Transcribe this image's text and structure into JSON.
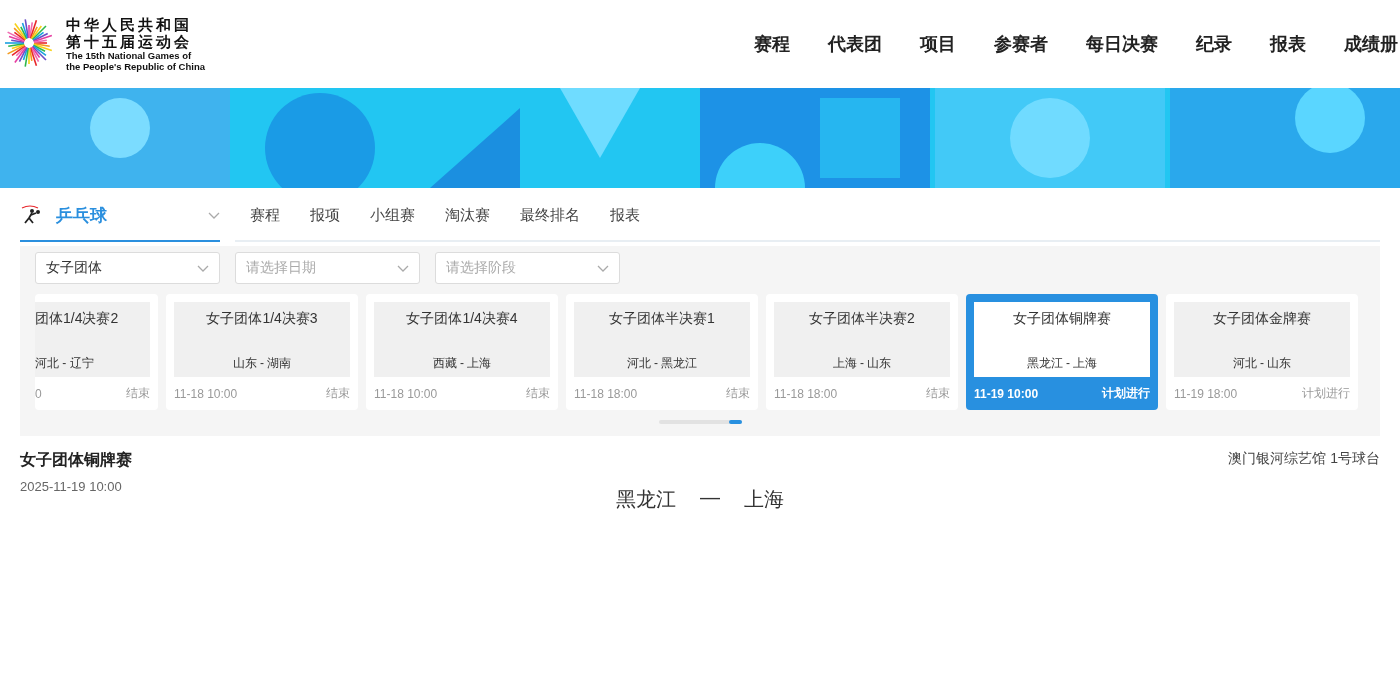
{
  "logo": {
    "title_cn": [
      "中华人民共和国",
      "第十五届运动会"
    ],
    "title_en": [
      "The 15th National Games of",
      "the People's Republic of China"
    ]
  },
  "nav": [
    {
      "label": "赛程"
    },
    {
      "label": "代表团"
    },
    {
      "label": "项目"
    },
    {
      "label": "参赛者"
    },
    {
      "label": "每日决赛"
    },
    {
      "label": "纪录"
    },
    {
      "label": "报表"
    },
    {
      "label": "成绩册"
    }
  ],
  "sport": {
    "name": "乒乓球",
    "tabs": [
      {
        "label": "赛程"
      },
      {
        "label": "报项"
      },
      {
        "label": "小组赛"
      },
      {
        "label": "淘汰赛"
      },
      {
        "label": "最终排名"
      },
      {
        "label": "报表"
      }
    ]
  },
  "filters": [
    {
      "value": "女子团体"
    },
    {
      "placeholder": "请选择日期"
    },
    {
      "placeholder": "请选择阶段"
    }
  ],
  "matches": [
    {
      "kind": "partial",
      "title": "团体1/4决赛2",
      "teams": "河北 - 辽宁",
      "time": "0",
      "status": "结束",
      "selected": false
    },
    {
      "kind": "full",
      "title": "女子团体1/4决赛3",
      "teams": "山东 - 湖南",
      "time": "11-18  10:00",
      "status": "结束",
      "selected": false
    },
    {
      "kind": "full",
      "title": "女子团体1/4决赛4",
      "teams": "西藏 - 上海",
      "time": "11-18  10:00",
      "status": "结束",
      "selected": false
    },
    {
      "kind": "full",
      "title": "女子团体半决赛1",
      "teams": "河北 - 黑龙江",
      "time": "11-18  18:00",
      "status": "结束",
      "selected": false
    },
    {
      "kind": "full",
      "title": "女子团体半决赛2",
      "teams": "上海 - 山东",
      "time": "11-18  18:00",
      "status": "结束",
      "selected": false
    },
    {
      "kind": "full",
      "title": "女子团体铜牌赛",
      "teams": "黑龙江 - 上海",
      "time": "11-19  10:00",
      "status": "计划进行",
      "selected": true
    },
    {
      "kind": "full",
      "title": "女子团体金牌赛",
      "teams": "河北 - 山东",
      "time": "11-19  18:00",
      "status": "计划进行",
      "selected": false
    }
  ],
  "detail": {
    "title": "女子团体铜牌赛",
    "date": "2025-11-19 10:00",
    "venue": "澳门银河综艺馆 1号球台",
    "home": "黑龙江",
    "separator": "—",
    "away": "上海"
  }
}
